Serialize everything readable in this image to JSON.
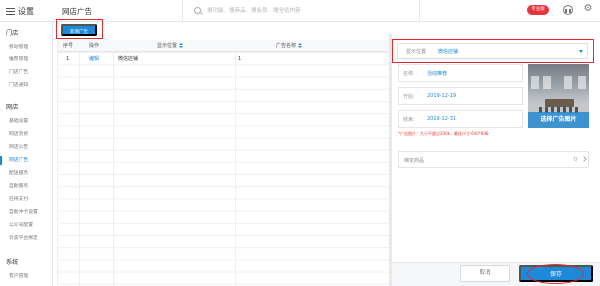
{
  "header": {
    "settings_label": "设置",
    "page_title": "网店广告",
    "search_placeholder": "搜功能、搜商品、搜会员…搜全站内容",
    "pro_badge": "专业版"
  },
  "sidebar": {
    "groups": [
      {
        "label": "门店",
        "items": [
          {
            "label": "移动管理"
          },
          {
            "label": "推荐管理"
          },
          {
            "label": "门店广告"
          },
          {
            "label": "门店通知"
          }
        ]
      },
      {
        "label": "网店",
        "items": [
          {
            "label": "基础设置"
          },
          {
            "label": "网店装修"
          },
          {
            "label": "网店公告"
          },
          {
            "label": "网店广告",
            "active": true
          },
          {
            "label": "配送服务"
          },
          {
            "label": "自助服务"
          },
          {
            "label": "在线支付"
          },
          {
            "label": "自助冲卡设置"
          },
          {
            "label": "公众号配置"
          },
          {
            "label": "外卖平台绑定"
          }
        ]
      },
      {
        "label": "系统",
        "items": [
          {
            "label": "客户管理"
          }
        ]
      }
    ]
  },
  "toolbar": {
    "add_label": "新增广告"
  },
  "table": {
    "columns": [
      "序号",
      "操作",
      "显示位置",
      "广告名称"
    ],
    "rows": [
      {
        "index": "1",
        "action": "编辑",
        "position": "微信店铺",
        "name": "1"
      }
    ]
  },
  "panel": {
    "position_label": "显示位置",
    "position_value": "微信店铺",
    "name_label": "名称:",
    "name_value": "活动推荐",
    "start_label": "开始:",
    "start_value": "2019-12-19",
    "end_label": "结束:",
    "end_value": "2019-12-31",
    "image_note": "*广告图片：大小不超过200k，最佳尺寸:640*848",
    "image_caption": "选择广告图片",
    "goods_label": "绑定商品",
    "goods_count": "0",
    "cancel_label": "取消",
    "save_label": "保存"
  }
}
